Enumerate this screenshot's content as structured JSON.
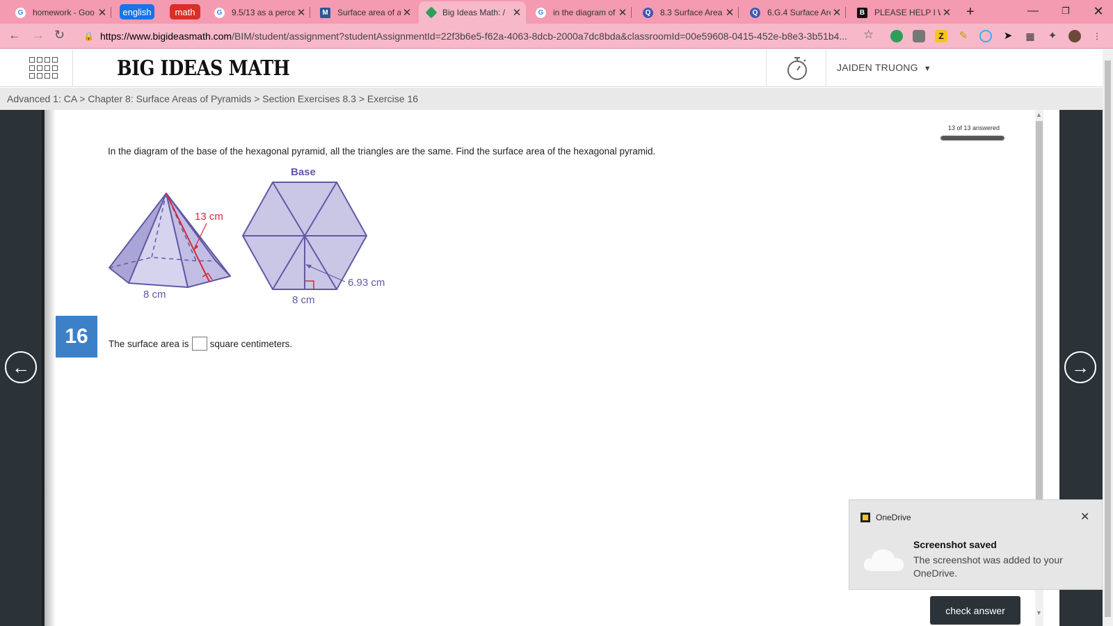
{
  "browser": {
    "tabs": [
      {
        "title": "homework - Goo",
        "icon": "google-icon"
      },
      {
        "title": "9.5/13 as a perce",
        "icon": "google-icon"
      },
      {
        "title": "Surface area of a",
        "icon": "m-icon"
      },
      {
        "title": "Big Ideas Math: /",
        "icon": "big-ideas-icon",
        "active": true
      },
      {
        "title": "in the diagram of",
        "icon": "google-icon"
      },
      {
        "title": "8.3 Surface Area",
        "icon": "quizlet-icon"
      },
      {
        "title": "6.G.4 Surface Are",
        "icon": "quizlet-icon"
      },
      {
        "title": "PLEASE HELP I W",
        "icon": "brainly-icon"
      }
    ],
    "tab_groups": [
      {
        "label": "english",
        "color": "#1a73e8"
      },
      {
        "label": "math",
        "color": "#d93025"
      }
    ],
    "url_host": "https://www.bigideasmath.com",
    "url_path": "/BIM/student/assignment?studentAssignmentId=22f3b6e5-f62a-4063-8dcb-2000a7dc8bda&classroomId=00e59608-0415-452e-b8e3-3b51b4..."
  },
  "header": {
    "brand": "BIG IDEAS MATH",
    "user": "JAIDEN TRUONG"
  },
  "breadcrumb": "Advanced 1: CA > Chapter 8: Surface Areas of Pyramids > Section Exercises 8.3 > Exercise 16",
  "progress": {
    "label": "13 of 13 answered",
    "fraction": 1.0
  },
  "question": {
    "prompt": "In the diagram of the base of the hexagonal pyramid, all the triangles are the same. Find the surface area of the hexagonal pyramid.",
    "number": "16",
    "answer_prefix": "The surface area is",
    "answer_suffix": "square centimeters."
  },
  "diagram": {
    "base_title": "Base",
    "slant_height": "13 cm",
    "pyramid_base_edge": "8 cm",
    "hex_apothem": "6.93 cm",
    "hex_side": "8 cm"
  },
  "actions": {
    "check_answer": "check answer"
  },
  "toast": {
    "app": "OneDrive",
    "title": "Screenshot saved",
    "message": "The screenshot was added to your OneDrive."
  },
  "colors": {
    "tabbar": "#f49ab1",
    "addressbar": "#f7b9c9",
    "accent_blue": "#3d80c8",
    "dark_side": "#2c3338",
    "diagram_fill": "#c9c6e6",
    "diagram_stroke": "#5f5aa6",
    "diagram_red": "#d8263a"
  }
}
